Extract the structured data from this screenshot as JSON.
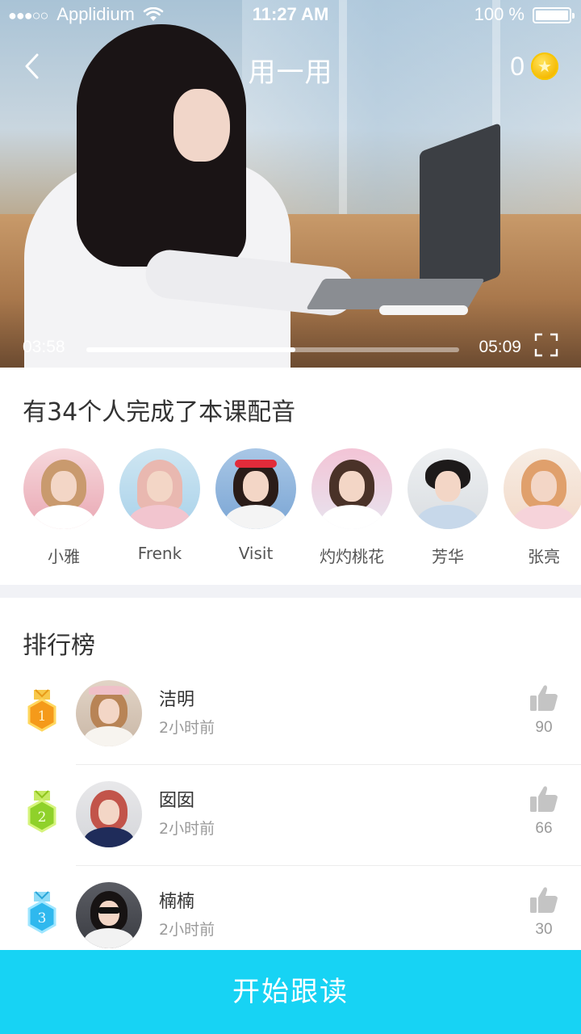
{
  "status_bar": {
    "signal": "●●●○○",
    "carrier": "Applidium",
    "time": "11:27 AM",
    "battery": "100 %"
  },
  "nav": {
    "title": "用一用",
    "coins": "0",
    "back_icon": "chevron-left-icon",
    "coin_icon": "star-coin-icon"
  },
  "player": {
    "current_time": "03:58",
    "total_time": "05:09",
    "progress": 0.56
  },
  "participants": {
    "heading": "有34个人完成了本课配音",
    "items": [
      {
        "name": "小雅"
      },
      {
        "name": "Frenk"
      },
      {
        "name": "Visit"
      },
      {
        "name": "灼灼桃花"
      },
      {
        "name": "芳华"
      },
      {
        "name": "张亮"
      }
    ]
  },
  "leaderboard": {
    "heading": "排行榜",
    "rows": [
      {
        "rank": "1",
        "name": "洁明",
        "time": "2小时前",
        "likes": "90",
        "medal_color": "#f59a1a"
      },
      {
        "rank": "2",
        "name": "囡囡",
        "time": "2小时前",
        "likes": "66",
        "medal_color": "#8fd12a"
      },
      {
        "rank": "3",
        "name": "楠楠",
        "time": "2小时前",
        "likes": "30",
        "medal_color": "#2fb8ee"
      }
    ]
  },
  "cta": {
    "label": "开始跟读"
  },
  "colors": {
    "accent": "#17d3f4",
    "secondary_text": "#9a9a9a",
    "like_icon": "#c4c4c4"
  }
}
